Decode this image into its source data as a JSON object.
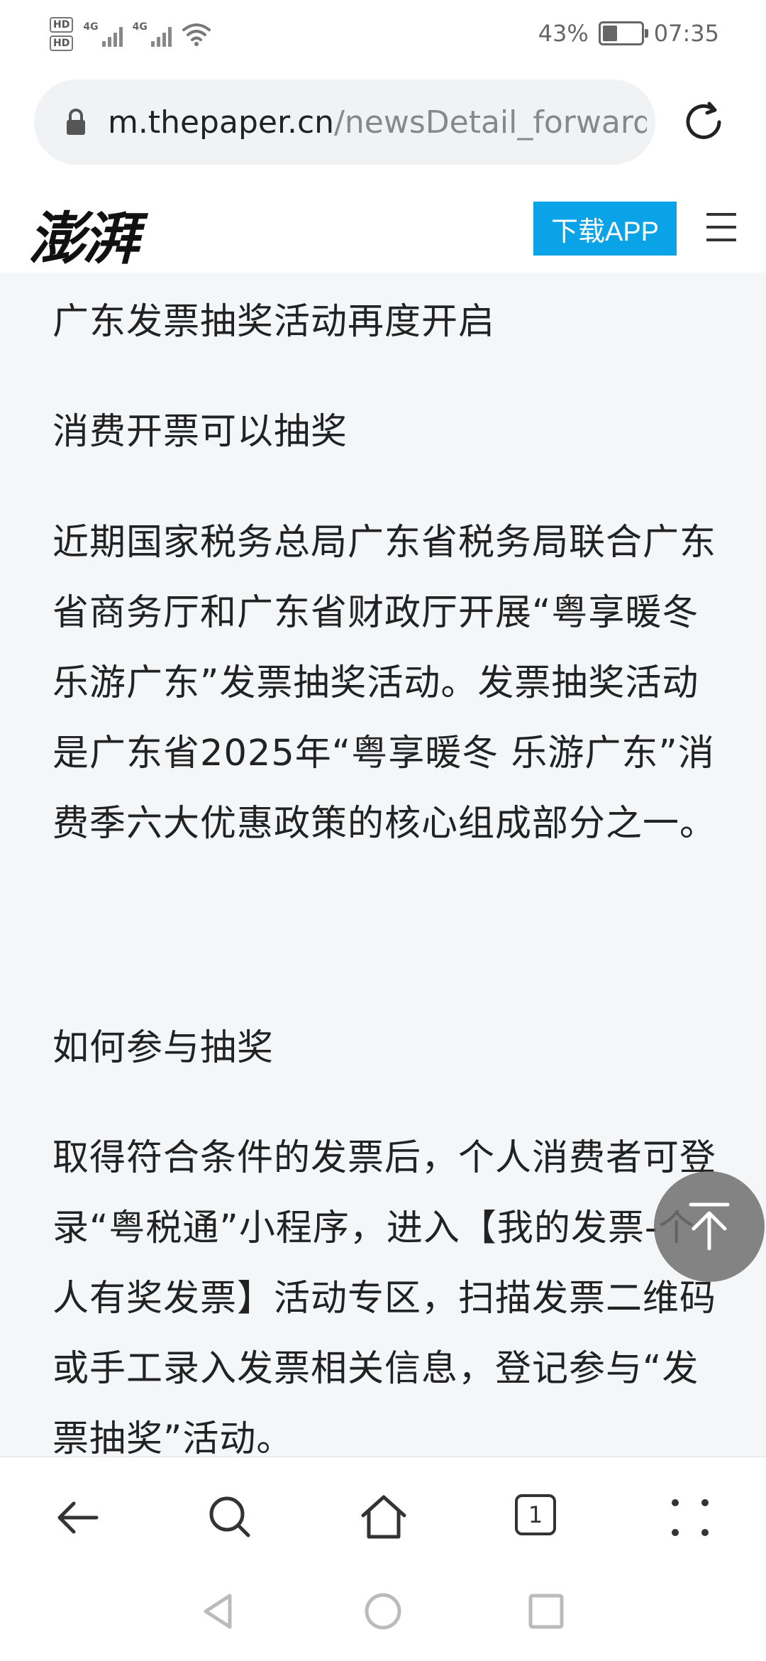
{
  "status_bar": {
    "hd1": "HD",
    "hd2": "HD",
    "net1": "4G",
    "net2": "4G",
    "battery": "43%",
    "battery_level": 0.43,
    "time": "07:35"
  },
  "browser": {
    "url_host": "m.thepaper.cn",
    "url_path": "/newsDetail_forward",
    "tab_count": "1"
  },
  "site": {
    "logo": "澎湃",
    "download_label": "下载APP"
  },
  "article": {
    "paragraphs": [
      "广东发票抽奖活动再度开启",
      "消费开票可以抽奖",
      "近期国家税务总局广东省税务局联合广东省商务厅和广东省财政厅开展“粤享暖冬 乐游广东”发票抽奖活动。发票抽奖活动是广东省2025年“粤享暖冬 乐游广东”消费季六大优惠政策的核心组成部分之一。",
      "如何参与抽奖",
      "取得符合条件的发票后，个人消费者可登录“粤税通”小程序，进入【我的发票-个人有奖发票】活动专区，扫描发票二维码或手工录入发票相关信息，登记参与“发票抽奖”活动。"
    ]
  }
}
